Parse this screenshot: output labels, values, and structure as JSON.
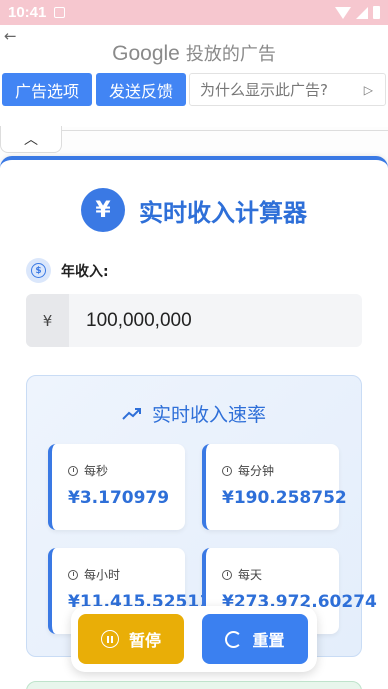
{
  "status_bar": {
    "time": "10:41"
  },
  "ad": {
    "brand": "Google",
    "brand_suffix": "投放的广告",
    "options_label": "广告选项",
    "feedback_label": "发送反馈",
    "why_label": "为什么显示此广告?"
  },
  "app": {
    "title": "实时收入计算器",
    "currency_symbol": "¥",
    "income_label": "年收入:",
    "income_value": "100,000,000",
    "rate_title": "实时收入速率",
    "rates": [
      {
        "label": "每秒",
        "value": "¥3.170979"
      },
      {
        "label": "每分钟",
        "value": "¥190.258752"
      },
      {
        "label": "每小时",
        "value": "¥11,415.52511"
      },
      {
        "label": "每天",
        "value": "¥273,972.60274"
      }
    ],
    "pause_label": "暂停",
    "reset_label": "重置"
  },
  "colors": {
    "primary": "#3a79e4",
    "pause": "#e9ae07",
    "reset": "#3b80f0",
    "status_bar": "#f6c7cf"
  }
}
